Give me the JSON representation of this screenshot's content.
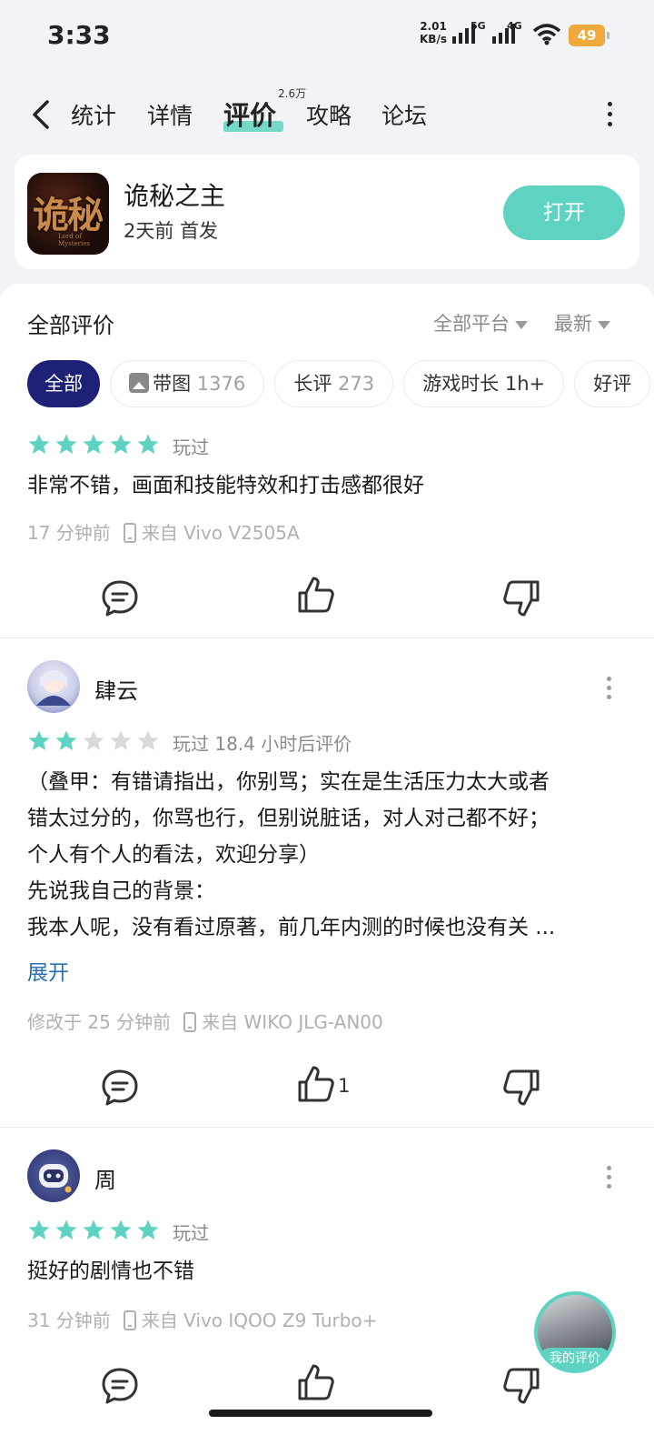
{
  "status_bar": {
    "time": "3:33",
    "speed_value": "2.01",
    "speed_unit": "KB/s",
    "net1": "5G",
    "net2": "4G",
    "battery": "49"
  },
  "tabs": [
    {
      "label": "统计"
    },
    {
      "label": "详情"
    },
    {
      "label": "评价",
      "count": "2.6万"
    },
    {
      "label": "攻略"
    },
    {
      "label": "论坛"
    }
  ],
  "game": {
    "name": "诡秘之主",
    "subtitle": "2天前 首发",
    "open_label": "打开",
    "logo_text": "诡秘",
    "logo_small": "Lord of Mysteries"
  },
  "reviews_header": {
    "title": "全部评价",
    "platform_filter": "全部平台",
    "sort": "最新"
  },
  "chips": [
    {
      "label": "全部",
      "count": ""
    },
    {
      "label": "带图",
      "count": "1376"
    },
    {
      "label": "长评",
      "count": "273"
    },
    {
      "label": "游戏时长 1h+",
      "count": ""
    },
    {
      "label": "好评",
      "count": ""
    }
  ],
  "reviews": [
    {
      "rating": 5,
      "played": "玩过",
      "text": "非常不错，画面和技能特效和打击感都很好",
      "time": "17 分钟前",
      "device": "来自 Vivo V2505A",
      "likes": ""
    },
    {
      "user": "肆云",
      "rating": 2,
      "played": "玩过 18.4 小时后评价",
      "lines": [
        "（叠甲：有错请指出，你别骂；实在是生活压力太大或者",
        "错太过分的，你骂也行，但别说脏话，对人对己都不好；",
        "个人有个人的看法，欢迎分享）",
        "先说我自己的背景：",
        "我本人呢，没有看过原著，前几年内测的时候也没有关 ..."
      ],
      "expand": "展开",
      "time": "修改于 25 分钟前",
      "device": "来自 WIKO JLG-AN00",
      "likes": "1"
    },
    {
      "user": "周",
      "rating": 5,
      "played": "玩过",
      "text": "挺好的剧情也不错",
      "time": "31 分钟前",
      "device": "来自 Vivo IQOO Z9 Turbo+",
      "likes": ""
    }
  ],
  "fab": {
    "label": "我的评价"
  },
  "colors": {
    "accent": "#5fd3c1",
    "chip_active": "#1f2176",
    "star_on": "#5fd3c1",
    "star_off": "#d9d9d9",
    "link": "#2d6fb5",
    "battery": "#f0a93c"
  }
}
